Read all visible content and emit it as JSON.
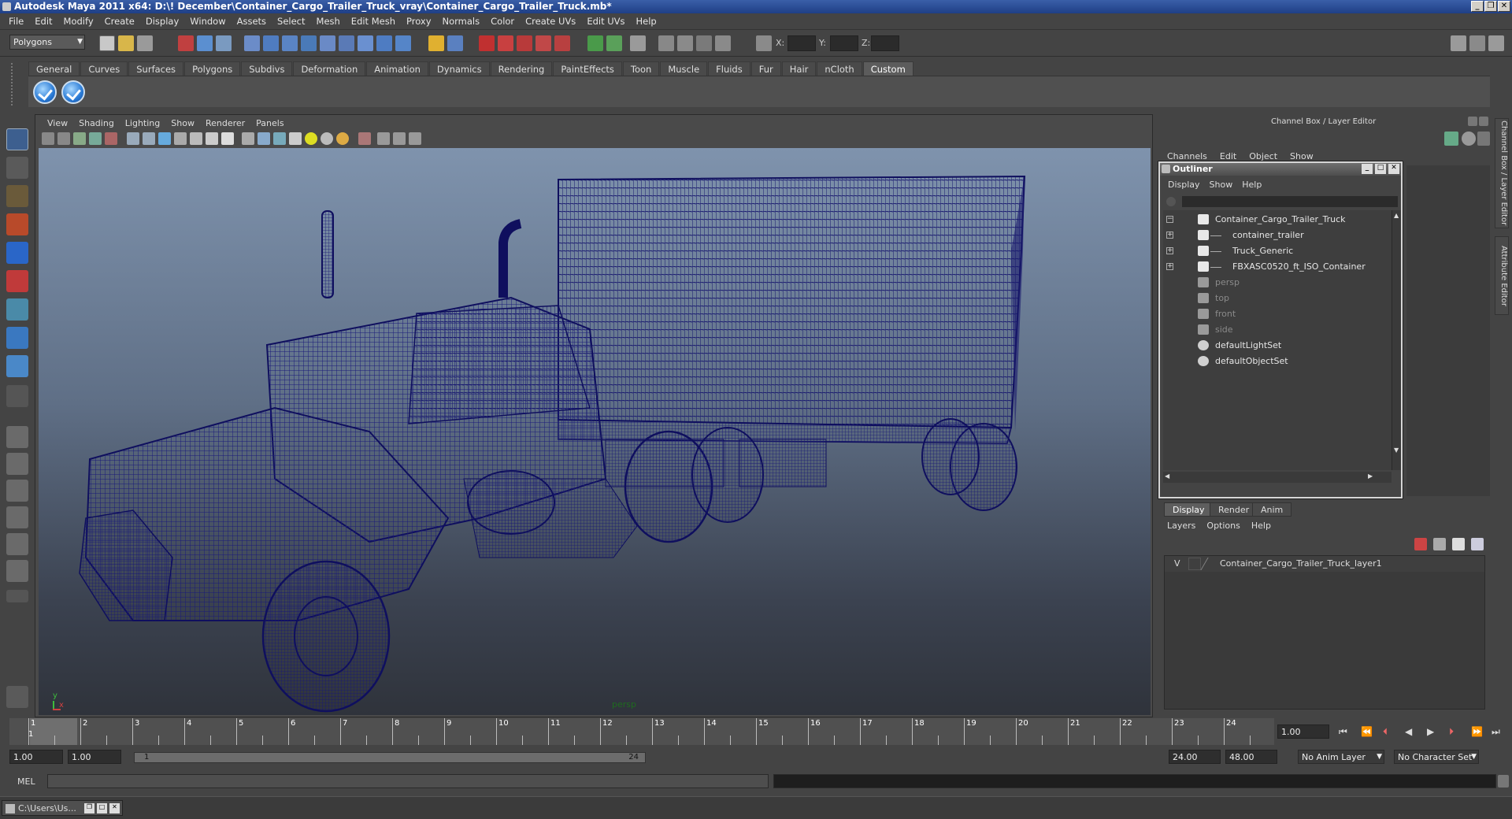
{
  "window": {
    "title": "Autodesk Maya 2011 x64: D:\\! December\\Container_Cargo_Trailer_Truck_vray\\Container_Cargo_Trailer_Truck.mb*",
    "btns": [
      "_",
      "❐",
      "✕"
    ]
  },
  "menubar": [
    "File",
    "Edit",
    "Modify",
    "Create",
    "Display",
    "Window",
    "Assets",
    "Select",
    "Mesh",
    "Edit Mesh",
    "Proxy",
    "Normals",
    "Color",
    "Create UVs",
    "Edit UVs",
    "Help"
  ],
  "statusline": {
    "mode": "Polygons",
    "x_label": "X:",
    "y_label": "Y:",
    "z_label": "Z:"
  },
  "shelf": {
    "tabs": [
      "General",
      "Curves",
      "Surfaces",
      "Polygons",
      "Subdivs",
      "Deformation",
      "Animation",
      "Dynamics",
      "Rendering",
      "PaintEffects",
      "Toon",
      "Muscle",
      "Fluids",
      "Fur",
      "Hair",
      "nCloth",
      "Custom"
    ],
    "active_tab": "Custom"
  },
  "viewport": {
    "menu": [
      "View",
      "Shading",
      "Lighting",
      "Show",
      "Renderer",
      "Panels"
    ],
    "camera": "persp",
    "axis_y": "y",
    "axis_x": "x",
    "wire_color": "#1a1a7a"
  },
  "right_panel": {
    "title": "Channel Box / Layer Editor",
    "menu": [
      "Channels",
      "Edit",
      "Object",
      "Show"
    ],
    "side_tabs": [
      "Channel Box / Layer Editor",
      "Attribute Editor"
    ]
  },
  "outliner": {
    "title": "Outliner",
    "menu": [
      "Display",
      "Show",
      "Help"
    ],
    "items": [
      {
        "label": "Container_Cargo_Trailer_Truck",
        "expander": "−",
        "icon": "transform-icon",
        "dim": false,
        "indent": 0
      },
      {
        "label": "container_trailer",
        "expander": "+",
        "icon": "transform-icon",
        "dim": false,
        "indent": 1
      },
      {
        "label": "Truck_Generic",
        "expander": "+",
        "icon": "transform-icon",
        "dim": false,
        "indent": 1
      },
      {
        "label": "FBXASC0520_ft_ISO_Container",
        "expander": "+",
        "icon": "transform-icon",
        "dim": false,
        "indent": 1
      },
      {
        "label": "persp",
        "expander": "",
        "icon": "camera-icon",
        "dim": true,
        "indent": 0
      },
      {
        "label": "top",
        "expander": "",
        "icon": "camera-icon",
        "dim": true,
        "indent": 0
      },
      {
        "label": "front",
        "expander": "",
        "icon": "camera-icon",
        "dim": true,
        "indent": 0
      },
      {
        "label": "side",
        "expander": "",
        "icon": "camera-icon",
        "dim": true,
        "indent": 0
      },
      {
        "label": "defaultLightSet",
        "expander": "",
        "icon": "set-icon",
        "dim": false,
        "indent": 0
      },
      {
        "label": "defaultObjectSet",
        "expander": "",
        "icon": "set-icon",
        "dim": false,
        "indent": 0
      }
    ]
  },
  "layer_editor": {
    "tabs": [
      "Display",
      "Render",
      "Anim"
    ],
    "active_tab": "Display",
    "menu": [
      "Layers",
      "Options",
      "Help"
    ],
    "layers": [
      {
        "visible": "V",
        "name": "Container_Cargo_Trailer_Truck_layer1"
      }
    ]
  },
  "timeline": {
    "frames": [
      "1",
      "2",
      "3",
      "4",
      "5",
      "6",
      "7",
      "8",
      "9",
      "10",
      "11",
      "12",
      "13",
      "14",
      "15",
      "16",
      "17",
      "18",
      "19",
      "20",
      "21",
      "22",
      "23",
      "24"
    ],
    "current_frame": "1.00",
    "current_marker": "1"
  },
  "range": {
    "start": "1.00",
    "playback_start": "1.00",
    "slider_start": "1",
    "slider_end": "24",
    "playback_end": "24.00",
    "end": "48.00",
    "anim_layer": "No Anim Layer",
    "character_set": "No Character Set"
  },
  "cmdline": {
    "label": "MEL"
  },
  "taskbar": {
    "item": "C:\\Users\\Us..."
  }
}
